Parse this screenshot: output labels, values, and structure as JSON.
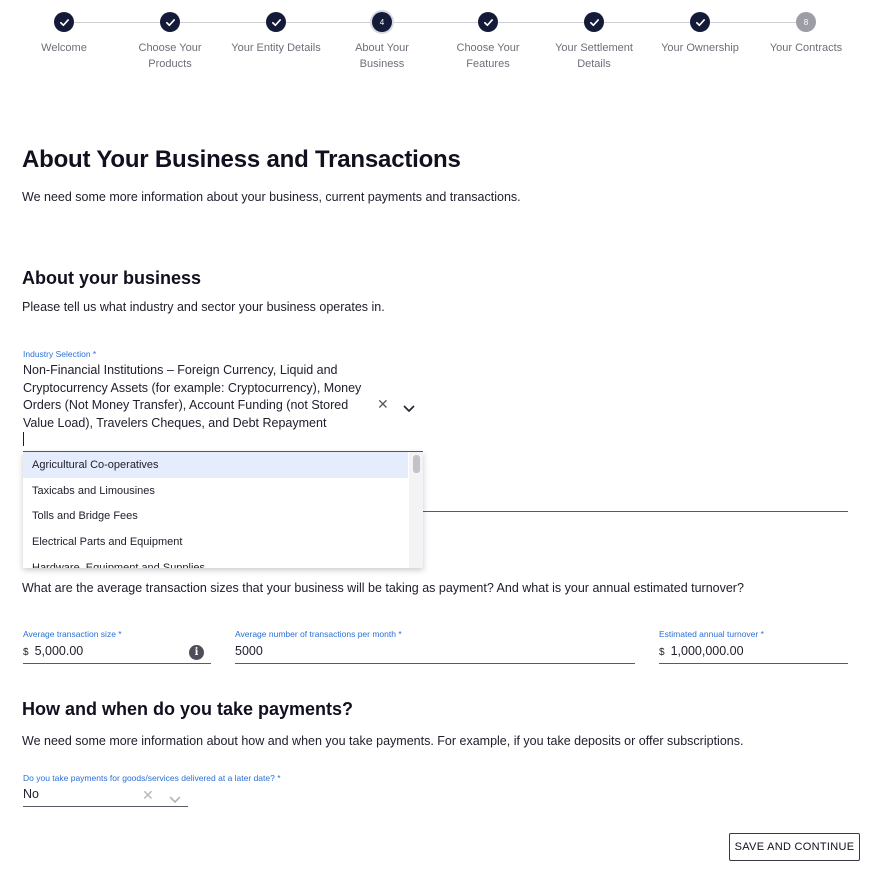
{
  "stepper": {
    "steps": [
      {
        "label": "Welcome",
        "state": "done"
      },
      {
        "label": "Choose Your Products",
        "state": "done"
      },
      {
        "label": "Your Entity Details",
        "state": "done"
      },
      {
        "label": "About Your Business",
        "state": "current",
        "number": "4"
      },
      {
        "label": "Choose Your Features",
        "state": "done"
      },
      {
        "label": "Your Settlement Details",
        "state": "done"
      },
      {
        "label": "Your Ownership",
        "state": "done"
      },
      {
        "label": "Your Contracts",
        "state": "future",
        "number": "8"
      }
    ]
  },
  "page": {
    "title": "About Your Business and Transactions",
    "intro": "We need some more information about your business, current payments and transactions."
  },
  "about_business": {
    "heading": "About your business",
    "text": "Please tell us what industry and sector your business operates in.",
    "industry_label": "Industry Selection *",
    "industry_value": "Non-Financial Institutions – Foreign Currency, Liquid and Cryptocurrency Assets (for example: Cryptocurrency), Money Orders (Not Money Transfer), Account Funding (not Stored Value Load), Travelers Cheques, and Debt Repayment",
    "options": [
      "Agricultural Co-operatives",
      "Taxicabs and Limousines",
      "Tolls and Bridge Fees",
      "Electrical Parts and Equipment",
      "Hardware, Equipment and Supplies"
    ]
  },
  "transactions": {
    "text": "What are the average transaction sizes that your business will be taking as payment? And what is your annual estimated turnover?",
    "avg_size_label": "Average transaction size *",
    "avg_size_currency": "$",
    "avg_size_value": "5,000.00",
    "avg_count_label": "Average number of transactions per month *",
    "avg_count_value": "5000",
    "turnover_label": "Estimated annual turnover *",
    "turnover_currency": "$",
    "turnover_value": "1,000,000.00"
  },
  "payments": {
    "heading": "How and when do you take payments?",
    "text": "We need some more information about how and when you take payments. For example, if you take deposits or offer subscriptions.",
    "later_label": "Do you take payments for goods/services delivered at a later date? *",
    "later_value": "No"
  },
  "actions": {
    "save_label": "SAVE AND CONTINUE"
  },
  "colors": {
    "accent": "#2a6fd6",
    "step_done": "#141b38",
    "step_future": "#9d9da6",
    "highlight": "#e5ecfb"
  }
}
